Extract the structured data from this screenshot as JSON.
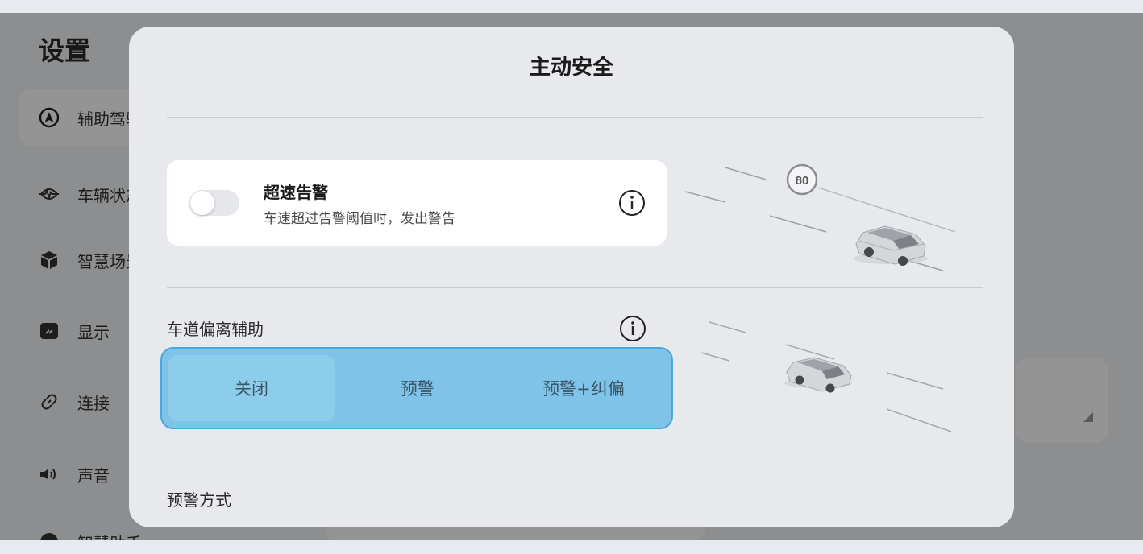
{
  "background": {
    "title": "设置",
    "nav": [
      {
        "label": "辅助驾驶",
        "icon": "navigation-arrow-icon",
        "active": true
      },
      {
        "label": "车辆状态",
        "icon": "heartbeat-icon",
        "active": false
      },
      {
        "label": "智慧场景",
        "icon": "cube-icon",
        "active": false
      },
      {
        "label": "显示",
        "icon": "display-icon",
        "active": false
      },
      {
        "label": "连接",
        "icon": "link-icon",
        "active": false
      },
      {
        "label": "声音",
        "icon": "speaker-icon",
        "active": false
      },
      {
        "label": "智慧助手",
        "icon": "assistant-icon",
        "active": false
      }
    ]
  },
  "modal": {
    "title": "主动安全",
    "speed_warning": {
      "title": "超速告警",
      "description": "车速超过告警阈值时，发出警告",
      "enabled": false
    },
    "speed_sign": "80",
    "lane_departure": {
      "label": "车道偏离辅助",
      "options": [
        "关闭",
        "预警",
        "预警+纠偏"
      ],
      "selected": "关闭"
    },
    "warning_method_label": "预警方式"
  },
  "colors": {
    "accent": "#4aa8e0",
    "segment_fill": "#7fc3e8",
    "modal_bg": "#e8e9ec"
  }
}
